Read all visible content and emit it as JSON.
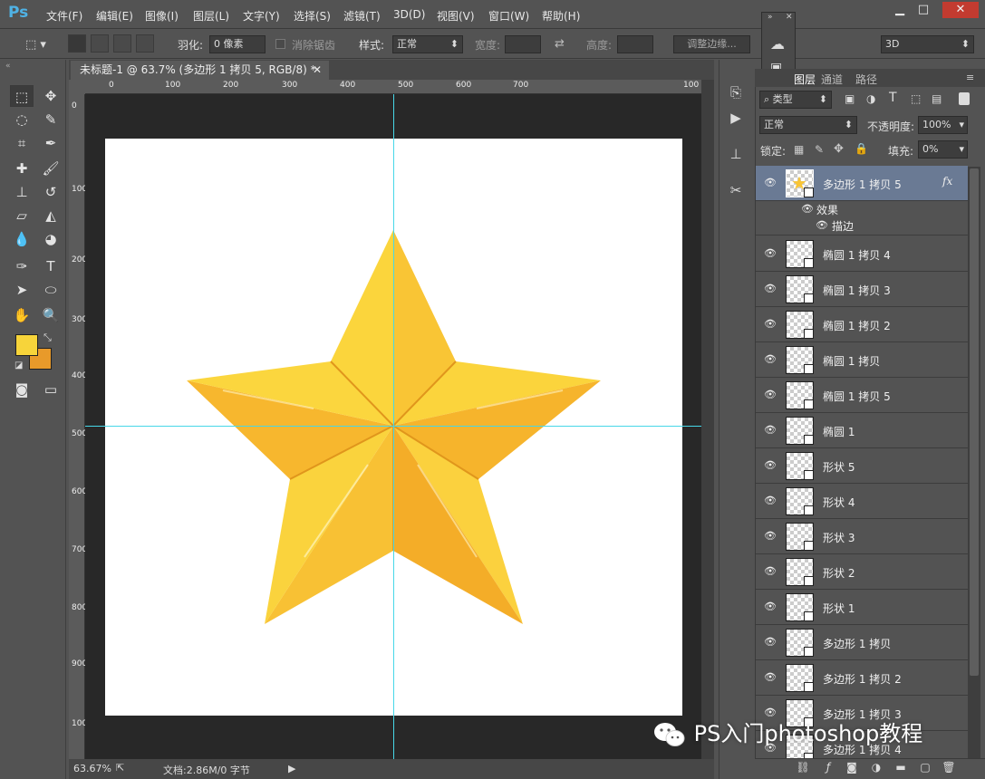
{
  "app": {
    "logo": "Ps"
  },
  "menu": [
    "文件(F)",
    "编辑(E)",
    "图像(I)",
    "图层(L)",
    "文字(Y)",
    "选择(S)",
    "滤镜(T)",
    "3D(D)",
    "视图(V)",
    "窗口(W)",
    "帮助(H)"
  ],
  "window_controls": {
    "minimize": "▁",
    "maximize": "□",
    "close": "✕"
  },
  "options": {
    "feather_label": "羽化:",
    "feather_value": "0 像素",
    "antialias_label": "消除锯齿",
    "style_label": "样式:",
    "style_value": "正常",
    "width_label": "宽度:",
    "height_label": "高度:",
    "refine_edge": "调整边缘...",
    "workspace": "3D"
  },
  "document": {
    "tab_title": "未标题-1 @ 63.7% (多边形 1 拷贝 5, RGB/8) *",
    "ruler_h": [
      "0",
      "100",
      "200",
      "300",
      "400",
      "500",
      "600",
      "700",
      "100"
    ],
    "ruler_v": [
      "0",
      "100",
      "200",
      "300",
      "400",
      "500",
      "600",
      "700",
      "800",
      "900",
      "100"
    ]
  },
  "status": {
    "zoom": "63.67%",
    "doc_info": "文档:2.86M/0 字节"
  },
  "layers_panel": {
    "tabs": [
      "图层",
      "通道",
      "路径"
    ],
    "filter_kind": "类型",
    "blend_mode": "正常",
    "opacity_label": "不透明度:",
    "opacity_value": "100%",
    "lock_label": "锁定:",
    "fill_label": "填充:",
    "fill_value": "0%",
    "selected_layer": {
      "name": "多边形 1 拷贝 5",
      "fx": "fx",
      "effects_label": "效果",
      "stroke_label": "描边"
    },
    "layers": [
      "椭圆 1 拷贝 4",
      "椭圆 1 拷贝 3",
      "椭圆 1 拷贝 2",
      "椭圆 1 拷贝",
      "椭圆 1 拷贝 5",
      "椭圆 1",
      "形状 5",
      "形状 4",
      "形状 3",
      "形状 2",
      "形状 1",
      "多边形 1 拷贝",
      "多边形 1 拷贝 2",
      "多边形 1 拷贝 3",
      "多边形 1 拷贝 4"
    ]
  },
  "colors": {
    "foreground": "#f7d43a",
    "background": "#e89a2a",
    "guide": "#47d7e8",
    "star_light": "#fbd63e",
    "star_dark": "#f5b52e"
  },
  "watermark": "PS入门photoshop教程"
}
